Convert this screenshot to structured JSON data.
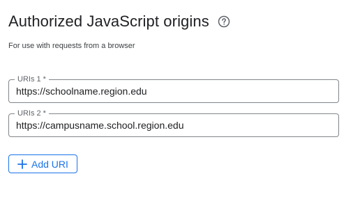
{
  "section": {
    "title": "Authorized JavaScript origins",
    "subtitle": "For use with requests from a browser",
    "help_icon": "help-circle-icon"
  },
  "uris": [
    {
      "label": "URIs 1 *",
      "value": "https://schoolname.region.edu"
    },
    {
      "label": "URIs 2 *",
      "value": "https://campusname.school.region.edu"
    }
  ],
  "add_button": {
    "label": "Add URI",
    "icon": "plus-icon"
  },
  "colors": {
    "accent": "#1a73e8",
    "border": "#80868b",
    "text": "#202124",
    "muted": "#5f6368"
  }
}
